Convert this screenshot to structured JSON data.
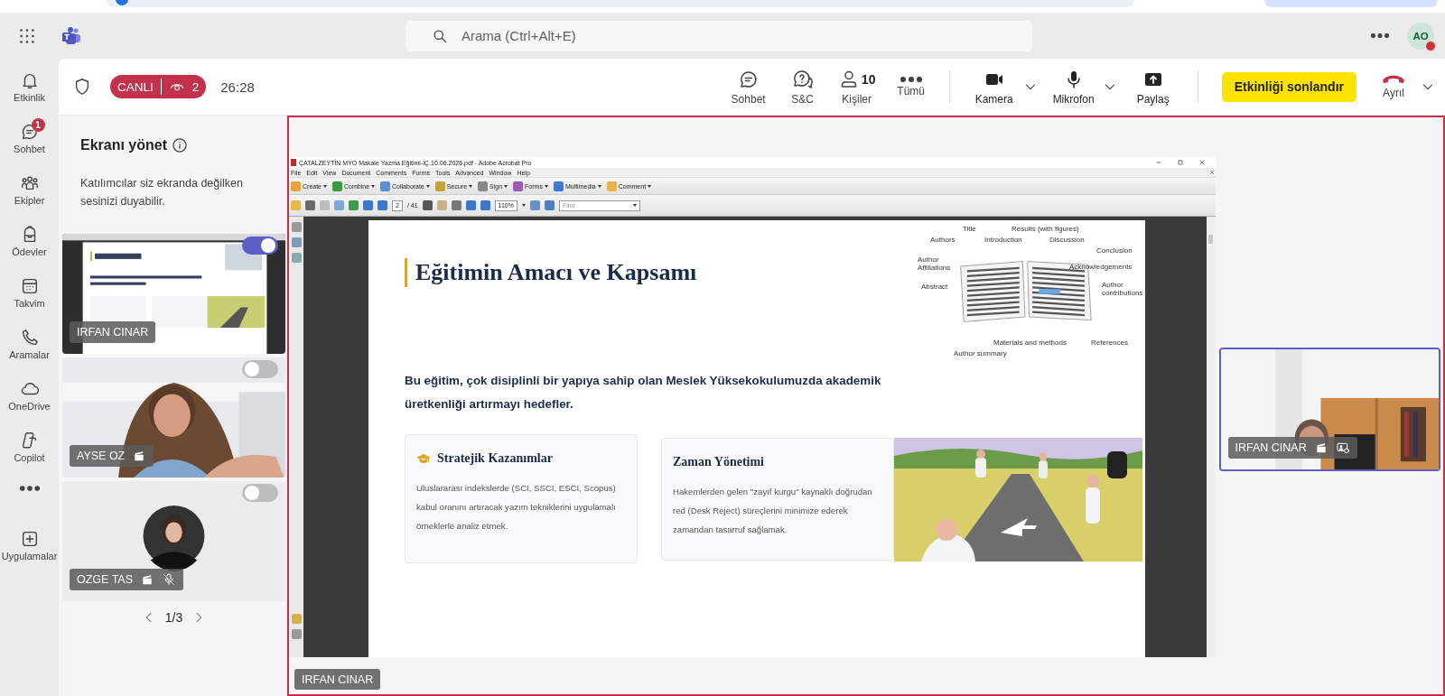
{
  "header": {
    "search": {
      "placeholder": "Arama (Ctrl+Alt+E)"
    },
    "avatar": {
      "initials": "AO"
    }
  },
  "rail": [
    {
      "kind": "bell",
      "label": "Etkinlik"
    },
    {
      "kind": "chat",
      "label": "Sohbet",
      "badge": "1"
    },
    {
      "kind": "people",
      "label": "Ekipler"
    },
    {
      "kind": "backpack",
      "label": "Ödevler"
    },
    {
      "kind": "calendar",
      "label": "Takvim"
    },
    {
      "kind": "phone",
      "label": "Aramalar"
    },
    {
      "kind": "cloud",
      "label": "OneDrive"
    },
    {
      "kind": "copilot",
      "label": "Copilot"
    },
    {
      "kind": "more"
    },
    {
      "kind": "plus",
      "label": "Uygulamalar"
    }
  ],
  "meeting_bar": {
    "live": "CANLI",
    "viewers": "2",
    "timer": "26:28",
    "actions": [
      {
        "kind": "chat",
        "label": "Sohbet"
      },
      {
        "kind": "qa",
        "label": "S&C"
      },
      {
        "kind": "person",
        "label": "Kişiler",
        "count": "10"
      },
      {
        "kind": "more",
        "label": "Tümü"
      }
    ],
    "devices": [
      {
        "kind": "camera",
        "label": "Kamera",
        "dropdown": true
      },
      {
        "kind": "mic",
        "label": "Mikrofon",
        "dropdown": true
      },
      {
        "kind": "share",
        "label": "Paylaş",
        "dropdown": false
      }
    ],
    "end_button": "Etkinliği sonlandır",
    "leave": "Ayrıl"
  },
  "panel": {
    "title": "Ekranı yönet",
    "description": "Katılımcılar siz ekranda değilken sesinizi duyabilir.",
    "tiles": [
      {
        "kind": "screen",
        "name": "IRFAN CINAR",
        "on": true,
        "badge": false,
        "muted": false
      },
      {
        "kind": "camera",
        "name": "AYSE OZ",
        "on": false,
        "badge": true,
        "muted": false
      },
      {
        "kind": "avatar",
        "name": "OZGE TAS",
        "on": false,
        "badge": true,
        "muted": true
      }
    ],
    "pager": "1/3"
  },
  "stage": {
    "presenter": "IRFAN CINAR",
    "video": {
      "name": "IRFAN CINAR",
      "badge": true,
      "sharing": true
    },
    "acrobat": {
      "title": "ÇATALZEYTİN MYO Makale Yazma Eğitimi-İÇ.10.06.2026.pdf - Adobe Acrobat Pro",
      "menu": [
        "File",
        "Edit",
        "View",
        "Document",
        "Comments",
        "Forms",
        "Tools",
        "Advanced",
        "Window",
        "Help"
      ],
      "tools": [
        "Create",
        "Combine",
        "Collaborate",
        "Secure",
        "Sign",
        "Forms",
        "Multimedia",
        "Comment"
      ],
      "page": "2",
      "pages": "/ 41",
      "zoom": "110%",
      "find_placeholder": "Find",
      "slide": {
        "title": "Eğitimin Amacı ve Kapsamı",
        "diagram_labels": [
          "Title",
          "Results (with figures)",
          "Authors",
          "Introduction",
          "Discussion",
          "Conclusion",
          "Author Affiliations",
          "Acknowledgements",
          "Abstract",
          "Author contributions",
          "Materials and methods",
          "References",
          "Author summary"
        ],
        "lead": "Bu eğitim, çok disiplinli bir yapıya sahip olan Meslek Yüksekokulumuzda akademik üretkenliği artırmayı hedefler.",
        "cards": [
          {
            "kind": "icon",
            "title": "Stratejik Kazanımlar",
            "text": "Uluslararası indekslerde (SCI, SSCI, ESCI, Scopus) kabul oranını artıracak yazım tekniklerini uygulamalı örneklerle analiz etmek."
          },
          {
            "kind": "plain",
            "title": "Zaman Yönetimi",
            "text": "Hakemlerden gelen \"zayıf kurgu\" kaynaklı doğrudan red (Desk Reject) süreçlerini minimize ederek zamandan tasarruf sağlamak."
          }
        ]
      }
    }
  }
}
